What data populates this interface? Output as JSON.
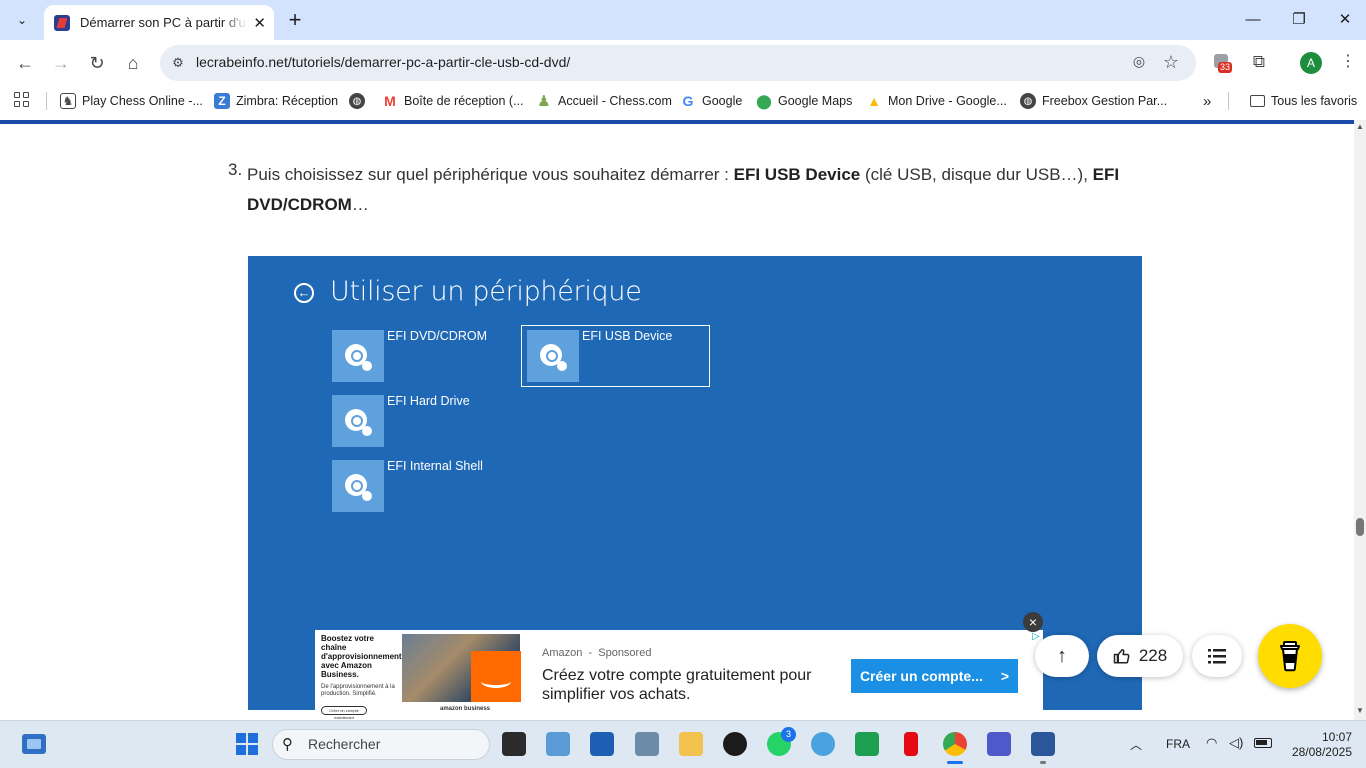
{
  "browser": {
    "tab_title": "Démarrer son PC à partir d'une clé USB",
    "url": "lecrabeinfo.net/tutoriels/demarrer-pc-a-partir-cle-usb-cd-dvd/",
    "extension_badge": "33",
    "avatar_letter": "A",
    "bookmarks": [
      {
        "label": "Play Chess Online -...",
        "icon": "chess-icon",
        "color": "#444444"
      },
      {
        "label": "Zimbra: Réception",
        "icon": "zimbra-icon",
        "color": "#3a7bd5"
      },
      {
        "label": "",
        "icon": "globe-icon",
        "color": "#444444"
      },
      {
        "label": "Boîte de réception (...",
        "icon": "gmail-icon",
        "color": "#ea4335"
      },
      {
        "label": "Accueil - Chess.com",
        "icon": "pawn-icon",
        "color": "#7fa650"
      },
      {
        "label": "Google",
        "icon": "google-icon",
        "color": "#4285f4"
      },
      {
        "label": "Google Maps",
        "icon": "maps-icon",
        "color": "#34a853"
      },
      {
        "label": "Mon Drive - Google...",
        "icon": "drive-icon",
        "color": "#fbbc04"
      },
      {
        "label": "Freebox Gestion Par...",
        "icon": "globe-icon",
        "color": "#444444"
      }
    ],
    "all_bookmarks": "Tous les favoris"
  },
  "article": {
    "step_number": "3.",
    "step_text_1": "Puis choisissez sur quel périphérique vous souhaitez démarrer : ",
    "step_bold_1": "EFI USB Device",
    "step_text_2": " (clé USB, disque dur USB…), ",
    "step_bold_2": "EFI DVD/CDROM",
    "step_text_3": "…"
  },
  "efi": {
    "title": "Utiliser un périphérique",
    "devices": [
      "EFI DVD/CDROM",
      "EFI Hard Drive",
      "EFI Internal Shell",
      "EFI USB Device"
    ]
  },
  "ad": {
    "left_headline": "Boostez votre chaîne d'approvisionnement avec Amazon Business.",
    "left_sub": "De l'approvisionnement à la production. Simplifié.",
    "left_button": "Créer un compte maintenant",
    "brand_small": "amazon business",
    "sponsor": "Amazon  -  Sponsored",
    "headline": "Créez votre compte gratuitement pour simplifier vos achats.",
    "cta": "Créer un compte...",
    "cta_arrow": ">",
    "close": "×"
  },
  "floating": {
    "likes": "228"
  },
  "taskbar": {
    "search_placeholder": "Rechercher",
    "whatsapp_badge": "3",
    "lang": "FRA",
    "time": "10:07",
    "date": "28/08/2025"
  }
}
